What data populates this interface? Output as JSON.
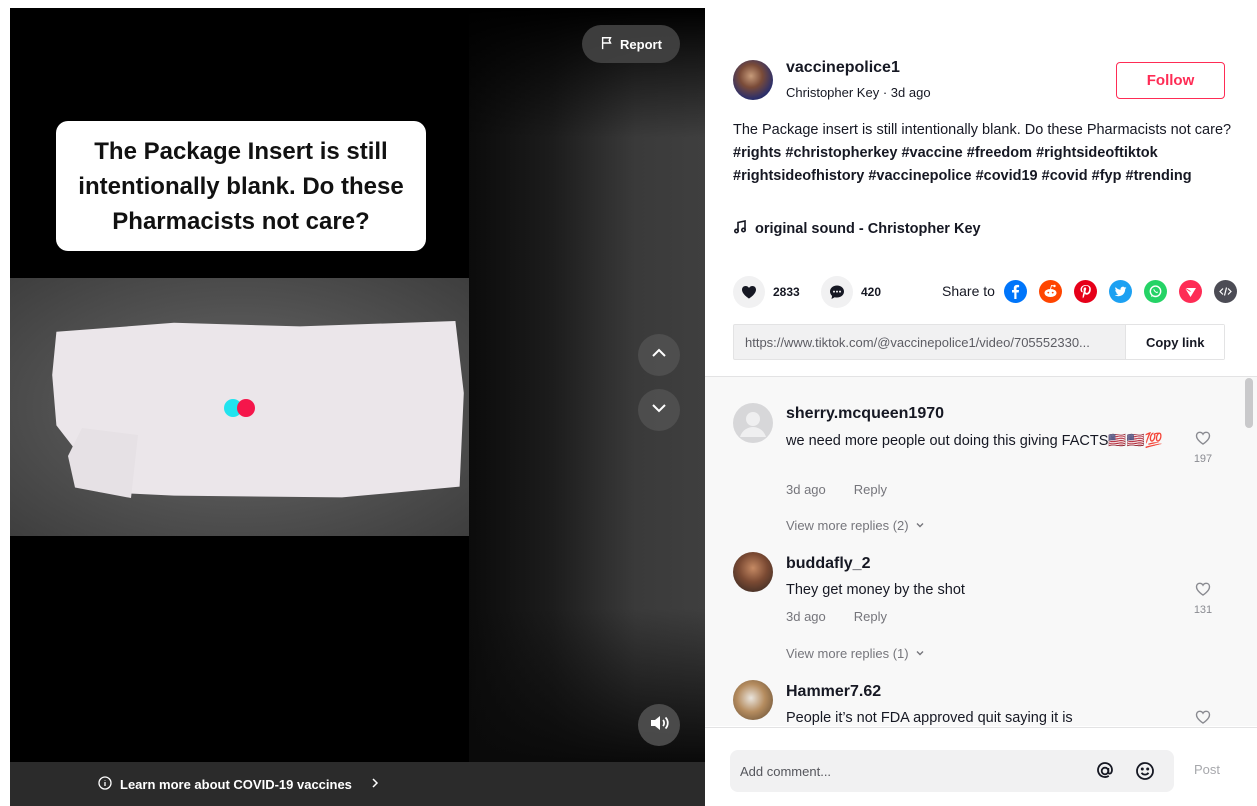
{
  "video": {
    "caption_overlay": "The Package Insert is still intentionally blank. Do these Pharmacists not care?",
    "report_label": "Report",
    "nav_up_icon": "chevron-up-icon",
    "nav_down_icon": "chevron-down-icon",
    "volume_icon": "volume-icon",
    "covid_banner": "Learn more about COVID-19 vaccines"
  },
  "author": {
    "username": "vaccinepolice1",
    "display_name": "Christopher Key",
    "separator": " · ",
    "posted": "3d ago",
    "follow_label": "Follow"
  },
  "description": {
    "text": "The Package insert is still intentionally blank. Do these Pharmacists not care?",
    "hashtags": [
      "#rights",
      "#christopherkey",
      "#vaccine",
      "#freedom",
      "#rightsideoftiktok",
      "#rightsideofhistory",
      "#vaccinepolice",
      "#covid19",
      "#covid",
      "#fyp",
      "#trending"
    ]
  },
  "music": {
    "label": "original sound - Christopher Key"
  },
  "stats": {
    "likes": "2833",
    "comments": "420",
    "share_label": "Share to"
  },
  "share_icons": [
    {
      "name": "facebook-icon",
      "color": "#0075fa"
    },
    {
      "name": "reddit-icon",
      "color": "#ff4500"
    },
    {
      "name": "pinterest-icon",
      "color": "#e60019"
    },
    {
      "name": "twitter-icon",
      "color": "#1da1f2"
    },
    {
      "name": "whatsapp-icon",
      "color": "#25d366"
    },
    {
      "name": "telegram-icon",
      "color": "#fe2c55"
    },
    {
      "name": "embed-icon",
      "color": "#4c4c55"
    }
  ],
  "link": {
    "url": "https://www.tiktok.com/@vaccinepolice1/video/705552330...",
    "copy_label": "Copy link"
  },
  "comments": [
    {
      "user": "sherry.mcqueen1970",
      "text": "we need more people out doing this giving FACTS🇺🇸🇺🇸💯",
      "time": "3d ago",
      "reply_label": "Reply",
      "likes": "197",
      "more_replies": "View more replies (2)"
    },
    {
      "user": "buddafly_2",
      "text": "They get money by the shot",
      "time": "3d ago",
      "reply_label": "Reply",
      "likes": "131",
      "more_replies": "View more replies (1)"
    },
    {
      "user": "Hammer7.62",
      "text": "People it’s not FDA approved quit saying it is",
      "time": "",
      "reply_label": "",
      "likes": "",
      "more_replies": ""
    }
  ],
  "add_comment": {
    "placeholder": "Add comment...",
    "mention_icon": "at-icon",
    "emoji_icon": "emoji-icon",
    "post_label": "Post"
  },
  "colors": {
    "accent": "#fe2c55",
    "text": "#161823",
    "muted": "#75757b"
  }
}
